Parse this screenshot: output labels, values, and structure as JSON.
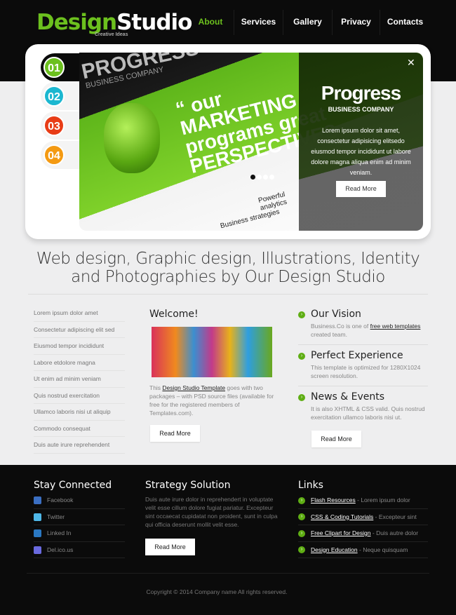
{
  "header": {
    "logo_a": "Design",
    "logo_b": "Studio",
    "tagline": "Creative Ideas",
    "nav": [
      {
        "label": "About",
        "active": true
      },
      {
        "label": "Services"
      },
      {
        "label": "Gallery"
      },
      {
        "label": "Privacy"
      },
      {
        "label": "Contacts"
      }
    ]
  },
  "slider": {
    "tabs": [
      {
        "label": "01",
        "color": "#6cc01e"
      },
      {
        "label": "02",
        "color": "#1bb7d0"
      },
      {
        "label": "03",
        "color": "#e83c16"
      },
      {
        "label": "04",
        "color": "#f49a12"
      }
    ],
    "banner_art": {
      "top": "PROGRESS",
      "top_sub": "BUSINESS COMPANY",
      "quote": "“ our MARKETING programs great PERSPECTIVES",
      "feature1": "Business strategies",
      "feature2": "Powerful analytics"
    },
    "overlay": {
      "title": "Progress",
      "subtitle": "BUSINESS COMPANY",
      "text": "Lorem ipsum dolor sit amet, consectetur adipisicing elitsedo eiusmod tempor incididunt ut labore dolore magna aliqua enim ad minim veniam.",
      "button": "Read More",
      "close": "✕"
    },
    "dots": 4,
    "active_dot": 1
  },
  "headline": "Web design, Graphic design, Illustrations, Identity and Photographies by Our Design Studio",
  "left_list": [
    "Lorem ipsum dolor amet",
    "Consectetur adipiscing elit sed",
    "Eiusmod tempor incididunt",
    "Labore etdolore magna",
    "Ut enim ad minim veniam",
    "Quis nostrud exercitation",
    "Ullamco laboris nisi ut aliquip",
    "Commodo consequat",
    "Duis aute irure reprehendent"
  ],
  "welcome": {
    "title": "Welcome!",
    "text_pre": "This ",
    "link": "Design Studio Template",
    "text_post": " goes with two packages – with PSD source files (available for free for the registered members of Templates.com).",
    "button": "Read More"
  },
  "features": [
    {
      "title": "Our Vision",
      "text_pre": "Business.Co is one of ",
      "link": "free web templates",
      "text_post": " created team."
    },
    {
      "title": "Perfect Experience",
      "text_pre": "This template is optimized for 1280X1024 screen resolution.",
      "link": "",
      "text_post": ""
    },
    {
      "title": "News & Events",
      "text_pre": "It is also XHTML & CSS valid. Quis nostrud exercitation ullamco laboris nisi ut.",
      "link": "",
      "text_post": ""
    }
  ],
  "features_button": "Read More",
  "footer": {
    "social_title": "Stay Connected",
    "social": [
      {
        "label": "Facebook",
        "icon": "facebook-icon",
        "color": "#3b6fc2"
      },
      {
        "label": "Twitter",
        "icon": "twitter-icon",
        "color": "#4fb8e8"
      },
      {
        "label": "Linked In",
        "icon": "linkedin-icon",
        "color": "#2a78c2"
      },
      {
        "label": "Del.ico.us",
        "icon": "delicious-icon",
        "color": "#6a6adf"
      }
    ],
    "strategy_title": "Strategy Solution",
    "strategy_text": "Duis aute irure dolor in reprehendert in voluptate velit esse cillum dolore fugiat pariatur. Excepteur sint occaecat cupidatat non proident, sunt in culpa qui officia deserunt mollit velit esse.",
    "strategy_button": "Read More",
    "links_title": "Links",
    "links": [
      {
        "link": "Flash Resources",
        "text": " - Lorem ipsum dolor"
      },
      {
        "link": "CSS & Coding Tutorials",
        "text": " - Excepteur sint"
      },
      {
        "link": "Free Clipart for Design",
        "text": " - Duis autre dolor"
      },
      {
        "link": "Design Education",
        "text": " - Neque quisquam"
      }
    ],
    "copyright": "Copyright © 2014 Company name All rights reserved."
  },
  "colors": {
    "accent": "#6cc01e",
    "dark": "#0b0b0b"
  }
}
